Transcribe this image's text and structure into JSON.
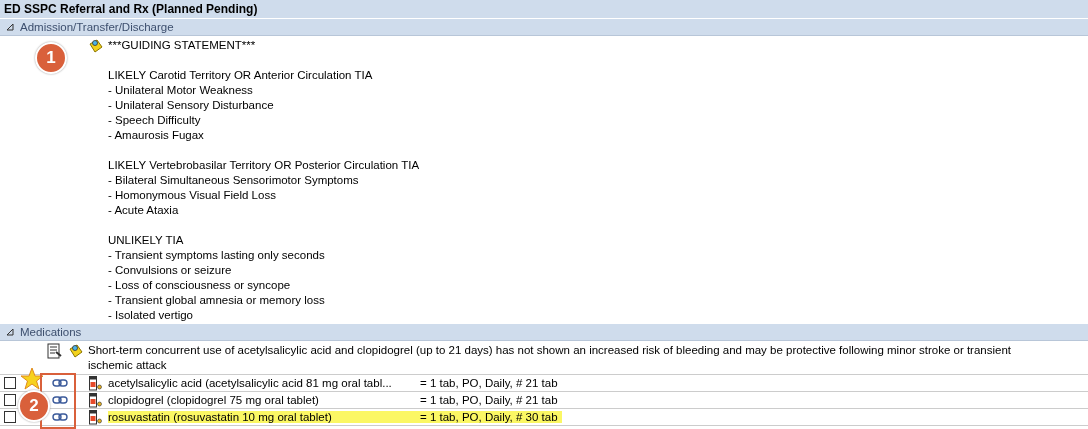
{
  "title": "ED SSPC Referral and Rx (Planned Pending)",
  "sections": [
    {
      "label": "Admission/Transfer/Discharge",
      "expanded": true,
      "kind": "statement",
      "blocks": [
        [
          "***GUIDING STATEMENT***"
        ],
        [
          "LIKELY Carotid Territory OR Anterior Circulation TIA",
          "- Unilateral Motor Weakness",
          "- Unilateral Sensory Disturbance",
          "- Speech Difficulty",
          "- Amaurosis Fugax"
        ],
        [
          "LIKELY Vertebrobasilar Territory OR Posterior Circulation TIA",
          "- Bilateral Simultaneous Sensorimotor Symptoms",
          "- Homonymous Visual Field Loss",
          "- Acute Ataxia"
        ],
        [
          "UNLIKELY TIA",
          "- Transient symptoms lasting only seconds",
          "- Convulsions or seizure",
          "- Loss of consciousness or syncope",
          "- Transient global amnesia or memory loss",
          "- Isolated vertigo"
        ]
      ]
    },
    {
      "label": "Medications",
      "expanded": true,
      "kind": "medications",
      "note": "Short-term concurrent use of acetylsalicylic acid and clopidogrel (up to 21 days) has not shown an increased risk of bleeding and may be protective following minor stroke or transient ischemic attack",
      "rows": [
        {
          "checked": false,
          "highlighted": false,
          "name": "acetylsalicylic acid (acetylsalicylic acid 81 mg oral tabl...",
          "details": "= 1 tab, PO, Daily, # 21 tab"
        },
        {
          "checked": false,
          "highlighted": false,
          "name": "clopidogrel (clopidogrel 75 mg oral tablet)",
          "details": "= 1 tab, PO, Daily, # 21 tab"
        },
        {
          "checked": false,
          "highlighted": true,
          "name": "rosuvastatin (rosuvastatin 10 mg oral tablet)",
          "details": "= 1 tab, PO, Daily, # 30 tab"
        }
      ]
    }
  ],
  "callouts": [
    "1",
    "2"
  ]
}
